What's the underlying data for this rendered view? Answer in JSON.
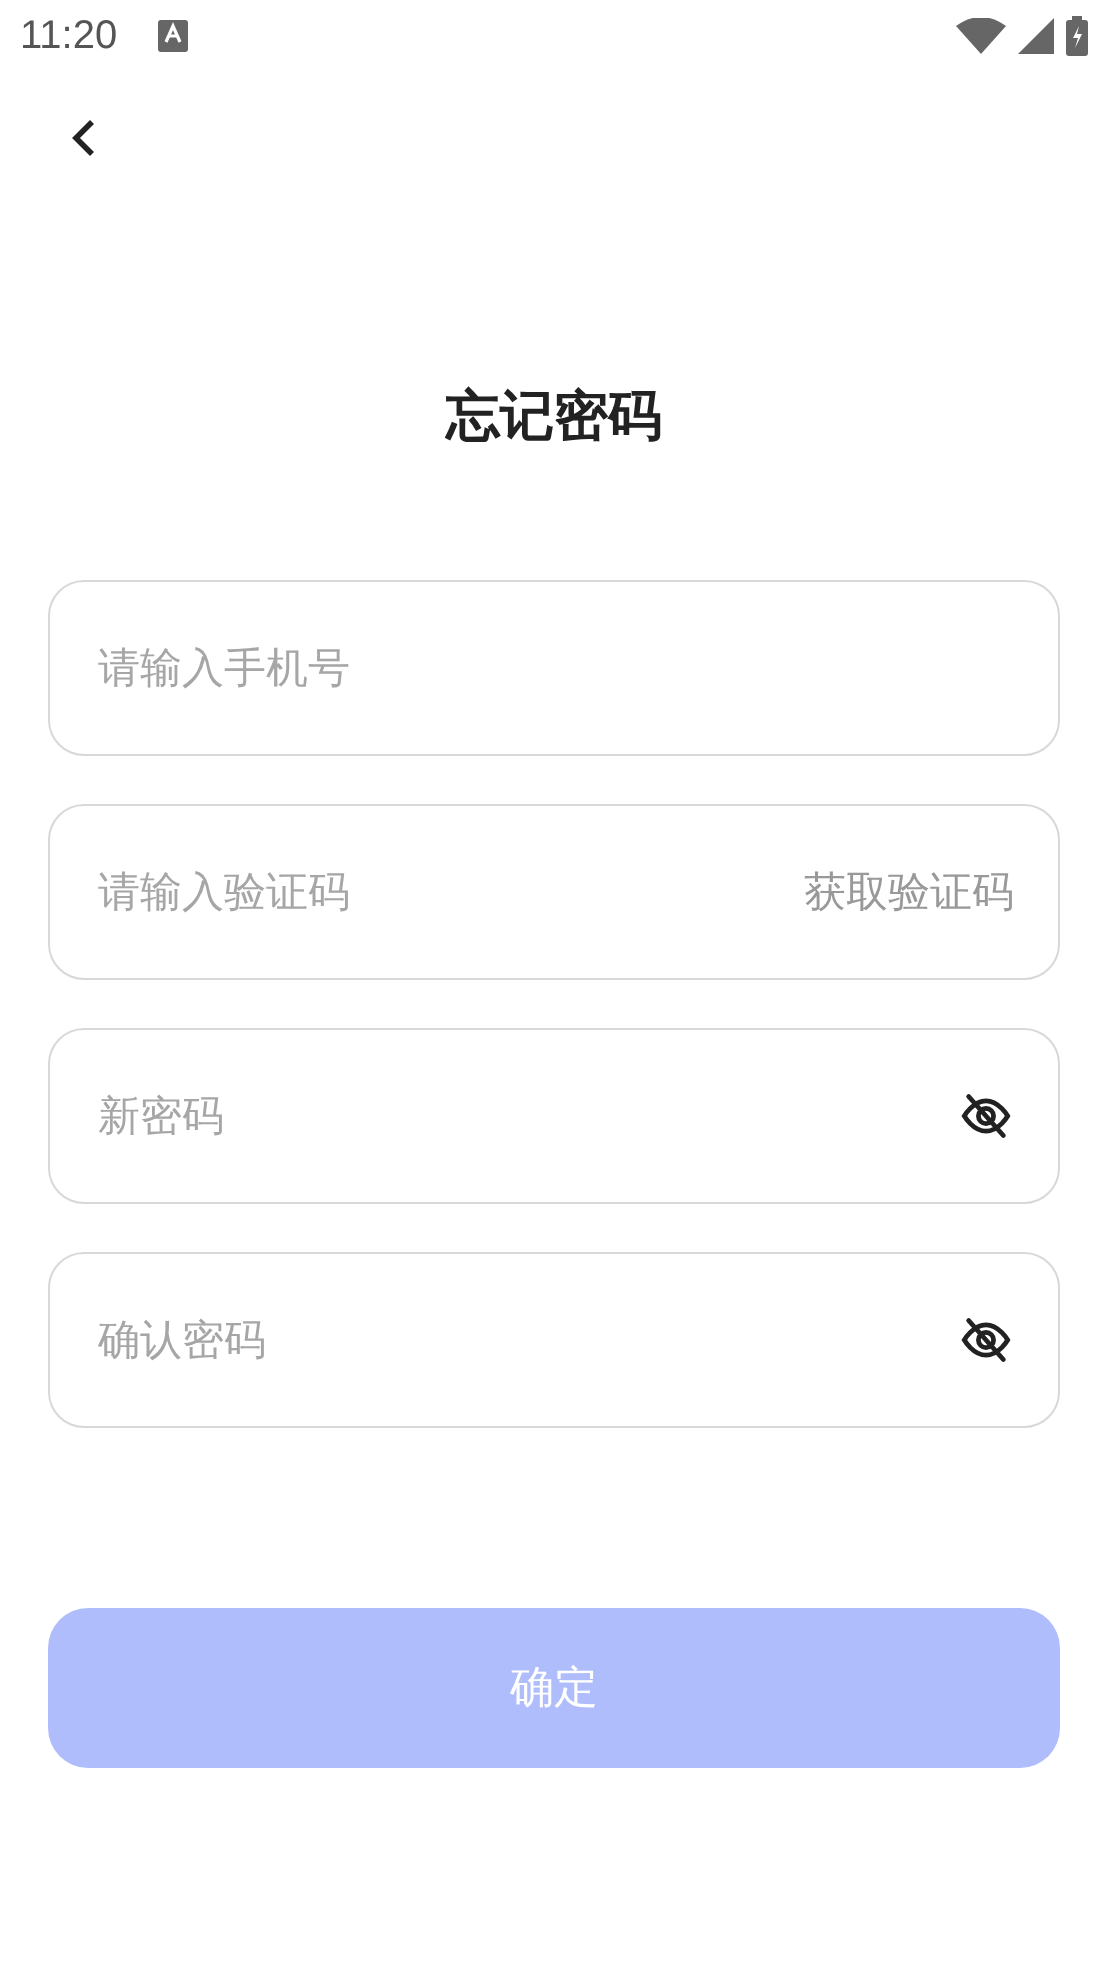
{
  "status_bar": {
    "time": "11:20"
  },
  "title": "忘记密码",
  "fields": [
    {
      "kind": "text",
      "placeholder": "请输入手机号"
    },
    {
      "kind": "code",
      "placeholder": "请输入验证码",
      "action": "获取验证码"
    },
    {
      "kind": "password",
      "placeholder": "新密码",
      "visible": false
    },
    {
      "kind": "password",
      "placeholder": "确认密码",
      "visible": false
    }
  ],
  "submit": {
    "label": "确定",
    "disabled": true
  }
}
